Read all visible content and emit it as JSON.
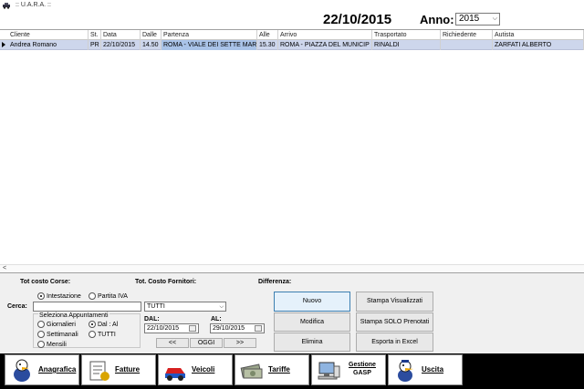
{
  "window": {
    "title": ":: U.A.R.A. ::"
  },
  "header": {
    "date": "22/10/2015",
    "anno_label": "Anno:",
    "anno_value": "2015"
  },
  "grid": {
    "columns": [
      "Cliente",
      "St.",
      "Data",
      "Dalle",
      "Partenza",
      "Alle",
      "Arrivo",
      "Trasportato",
      "Richiedente",
      "Autista"
    ],
    "rows": [
      [
        "Andrea Romano",
        "PR",
        "22/10/2015",
        "14.50",
        "ROMA - VIALE DEI SETTE MAR",
        "15.30",
        "ROMA - PIAZZA DEL MUNICIP",
        "RINALDI",
        "",
        "ZARFATI ALBERTO"
      ]
    ]
  },
  "totals": {
    "corse_label": "Tot costo Corse:",
    "fornitori_label": "Tot. Costo Fornitori:",
    "differenza_label": "Differenza:"
  },
  "search": {
    "label": "Cerca:",
    "radio_intestazione": "Intestazione",
    "radio_partita_iva": "Partita IVA",
    "input_value": "",
    "filter_value": "TUTTI"
  },
  "appointments": {
    "label": "Seleziona Appuntamenti",
    "giornalieri": "Giornalieri",
    "settimanali": "Settimanali",
    "mensili": "Mensili",
    "dal_al": "Dal : Al",
    "tutti": "TUTTI"
  },
  "dates": {
    "dal_label": "DAL:",
    "dal_value": "22/10/2015",
    "al_label": "AL:",
    "al_value": "29/10/2015"
  },
  "nav": {
    "prev": "<<",
    "today": "OGGI",
    "next": ">>"
  },
  "actions": {
    "nuovo": "Nuovo",
    "modifica": "Modifica",
    "elimina": "Elimina"
  },
  "print": {
    "visualizzati": "Stampa Visualizzati",
    "prenotati": "Stampa SOLO Prenotati",
    "excel": "Esporta in Excel"
  },
  "toolbar": {
    "anagrafica": "Anagrafica",
    "fatture": "Fatture",
    "veicoli": "Veicoli",
    "tariffe": "Tariffe",
    "gestione_line1": "Gestione",
    "gestione_line2": "GASP",
    "uscita": "Uscita"
  }
}
